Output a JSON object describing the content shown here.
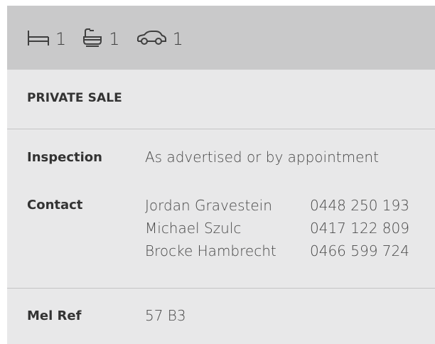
{
  "features": {
    "bedrooms": {
      "icon": "bed-icon",
      "count": "1"
    },
    "bathrooms": {
      "icon": "bath-icon",
      "count": "1"
    },
    "parking": {
      "icon": "car-icon",
      "count": "1"
    }
  },
  "sale_type": "PRIVATE SALE",
  "inspection": {
    "label": "Inspection",
    "value": "As advertised or by appointment"
  },
  "contact": {
    "label": "Contact",
    "people": [
      {
        "name": "Jordan Gravestein",
        "phone": "0448 250 193"
      },
      {
        "name": "Michael Szulc",
        "phone": "0417 122 809"
      },
      {
        "name": "Brocke Hambrecht",
        "phone": "0466 599 724"
      }
    ]
  },
  "mel_ref": {
    "label": "Mel Ref",
    "value": "57 B3"
  },
  "colors": {
    "header_bg": "#c9c9ca",
    "card_bg": "#e8e8e9",
    "divider": "#c4c4c5",
    "text": "#333333"
  }
}
